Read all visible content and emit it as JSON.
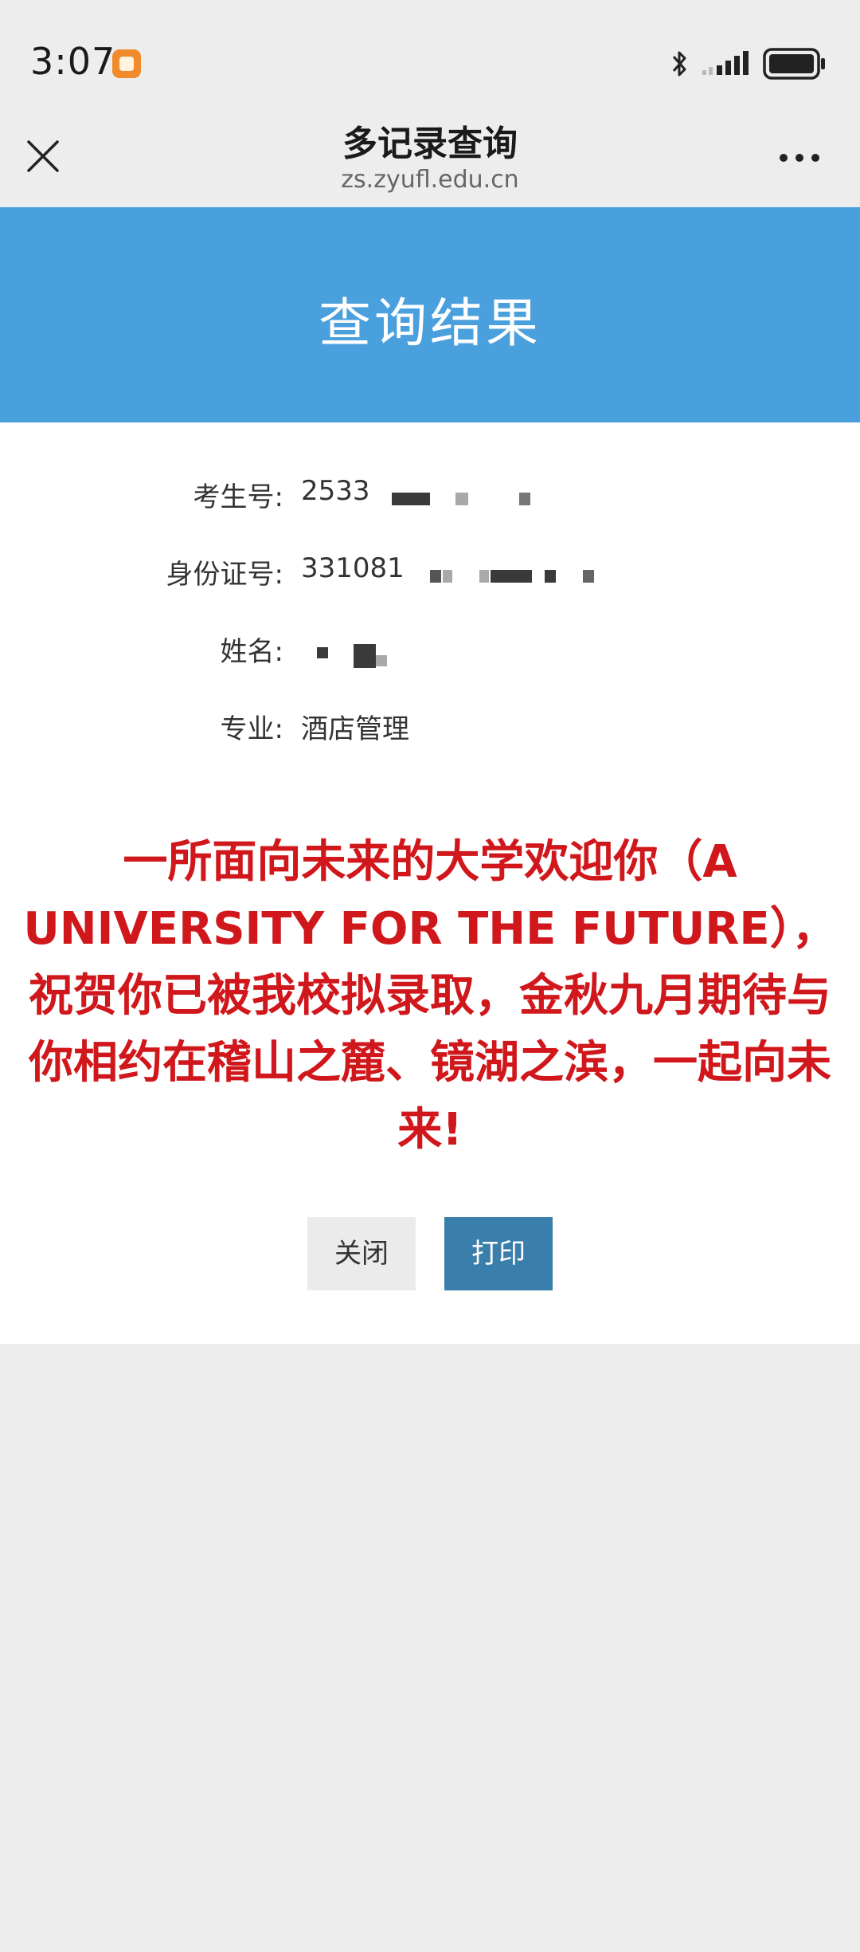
{
  "status_bar": {
    "time": "3:07",
    "icons": [
      "app-notification-icon",
      "bluetooth-icon",
      "signal-icon",
      "battery-icon"
    ]
  },
  "nav": {
    "title": "多记录查询",
    "url": "zs.zyufl.edu.cn",
    "icons": [
      "close-icon",
      "more-icon"
    ]
  },
  "banner": {
    "title": "查询结果",
    "color": "#4a9fdd"
  },
  "info": {
    "exam_no_label": "考生号:",
    "exam_no_value": "2533",
    "id_label": "身份证号:",
    "id_value": "331081",
    "name_label": "姓名:",
    "name_value": "",
    "major_label": "专业:",
    "major_value": "酒店管理"
  },
  "welcome_message": "一所面向未来的大学欢迎你（A UNIVERSITY FOR THE FUTURE），祝贺你已被我校拟录取，金秋九月期待与你相约在稽山之麓、镜湖之滨，一起向未来!",
  "buttons": {
    "close_label": "关闭",
    "print_label": "打印"
  },
  "colors": {
    "accent": "#4a9fdd",
    "welcome_text": "#d0171b",
    "print_button": "#3a7fab"
  }
}
